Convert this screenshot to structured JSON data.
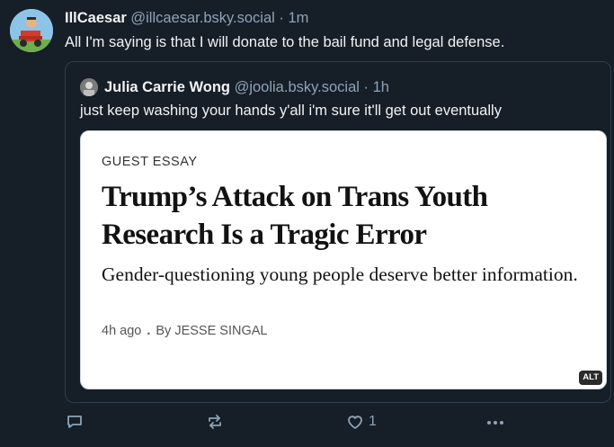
{
  "post": {
    "author_name": "IllCaesar",
    "author_handle": "@illcaesar.bsky.social",
    "separator": "·",
    "time": "1m",
    "text": "All I'm saying is that I will donate to the bail fund and legal defense."
  },
  "quote": {
    "author_name": "Julia Carrie Wong",
    "author_handle": "@joolia.bsky.social",
    "separator": "·",
    "time": "1h",
    "text": "just keep washing your hands y'all i'm sure it'll get out eventually",
    "card": {
      "kicker": "GUEST ESSAY",
      "headline": "Trump’s Attack on Trans Youth Research Is a Tragic Error",
      "dek": "Gender-questioning young people deserve better information.",
      "meta_time": "4h ago",
      "meta_dot": ".",
      "meta_byline": "By JESSE SINGAL",
      "alt_badge": "ALT"
    }
  },
  "actions": {
    "reply_icon": "reply-icon",
    "repost_icon": "repost-icon",
    "like_icon": "heart-icon",
    "like_count": "1",
    "more_icon": "more-icon"
  },
  "colors": {
    "background": "#161e27",
    "muted_text": "#8fa3b7",
    "border": "#2e3d4d"
  }
}
